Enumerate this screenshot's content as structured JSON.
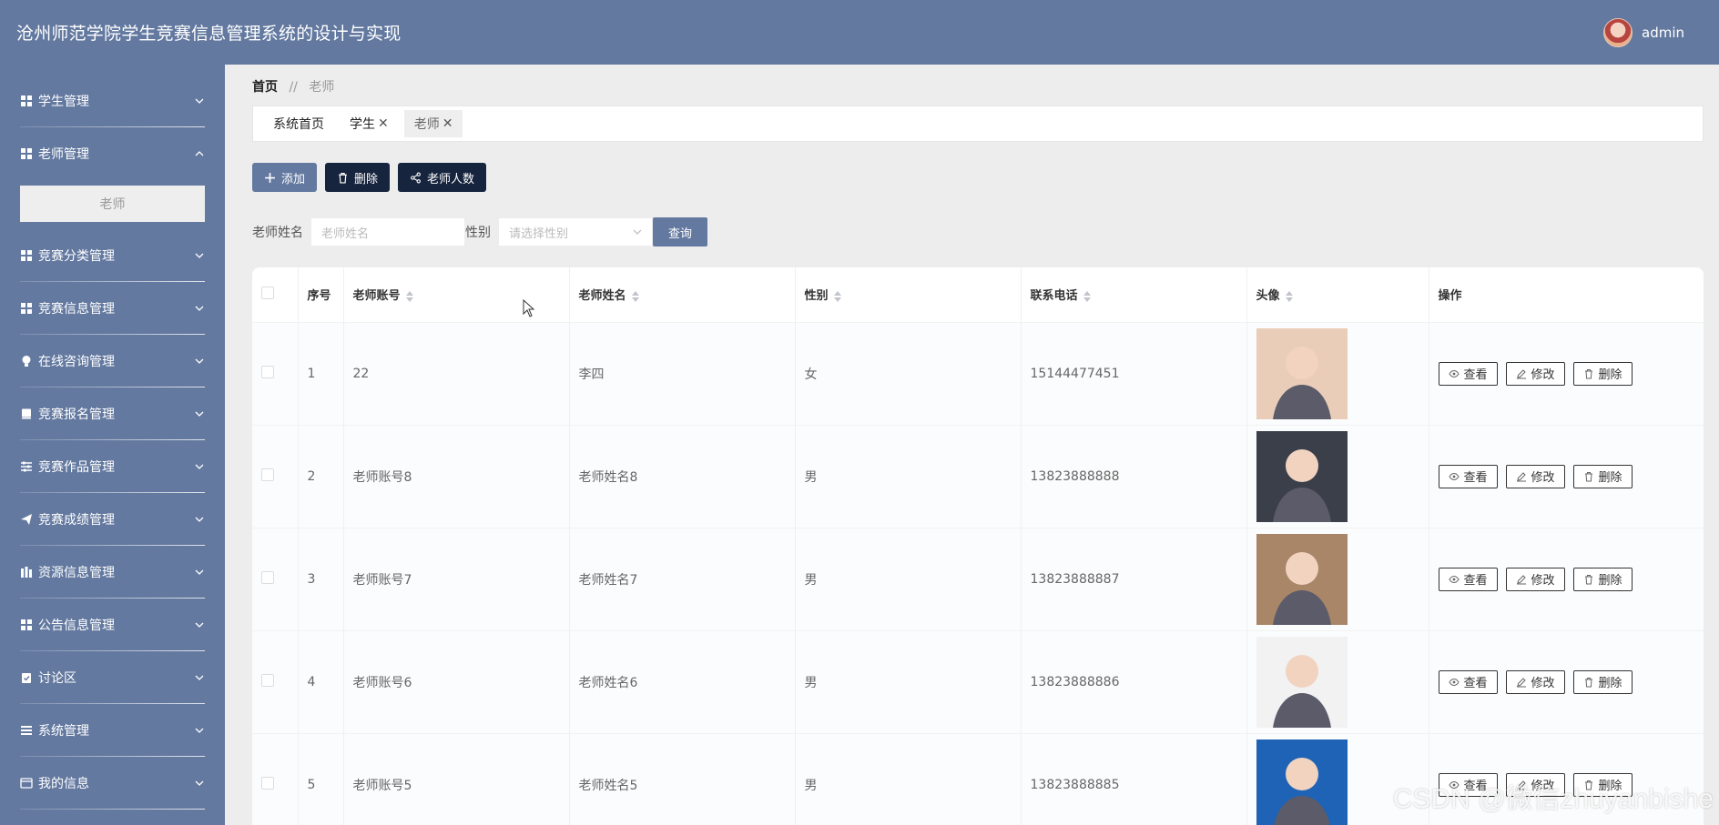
{
  "app": {
    "title": "沧州师范学院学生竞赛信息管理系统的设计与实现",
    "user": "admin"
  },
  "sidebar": {
    "items": [
      {
        "label": "学生管理",
        "icon": "grid-icon",
        "open": false
      },
      {
        "label": "老师管理",
        "icon": "grid-icon",
        "open": true,
        "children": [
          "老师"
        ]
      },
      {
        "label": "竞赛分类管理",
        "icon": "grid-icon",
        "open": false
      },
      {
        "label": "竞赛信息管理",
        "icon": "grid-icon",
        "open": false
      },
      {
        "label": "在线咨询管理",
        "icon": "bulb-icon",
        "open": false
      },
      {
        "label": "竞赛报名管理",
        "icon": "book-icon",
        "open": false
      },
      {
        "label": "竞赛作品管理",
        "icon": "sliders-icon",
        "open": false
      },
      {
        "label": "竞赛成绩管理",
        "icon": "plane-icon",
        "open": false
      },
      {
        "label": "资源信息管理",
        "icon": "columns-icon",
        "open": false
      },
      {
        "label": "公告信息管理",
        "icon": "grid-icon",
        "open": false
      },
      {
        "label": "讨论区",
        "icon": "clipboard-icon",
        "open": false
      },
      {
        "label": "系统管理",
        "icon": "list-icon",
        "open": false
      },
      {
        "label": "我的信息",
        "icon": "window-icon",
        "open": false
      }
    ]
  },
  "breadcrumb": {
    "home": "首页",
    "sep": "//",
    "current": "老师"
  },
  "tabs": [
    {
      "label": "系统首页",
      "closable": false,
      "active": false
    },
    {
      "label": "学生",
      "closable": true,
      "active": false
    },
    {
      "label": "老师",
      "closable": true,
      "active": true
    }
  ],
  "toolbar": {
    "add": "添加",
    "delete": "删除",
    "count": "老师人数"
  },
  "search": {
    "name_label": "老师姓名",
    "name_placeholder": "老师姓名",
    "gender_label": "性别",
    "gender_placeholder": "请选择性别",
    "query": "查询"
  },
  "table": {
    "headers": [
      "序号",
      "老师账号",
      "老师姓名",
      "性别",
      "联系电话",
      "头像",
      "操作"
    ],
    "rows": [
      {
        "index": "1",
        "account": "22",
        "name": "李四",
        "gender": "女",
        "phone": "15144477451",
        "photo_color": "#e9cdb8"
      },
      {
        "index": "2",
        "account": "老师账号8",
        "name": "老师姓名8",
        "gender": "男",
        "phone": "13823888888",
        "photo_color": "#3a3f49"
      },
      {
        "index": "3",
        "account": "老师账号7",
        "name": "老师姓名7",
        "gender": "男",
        "phone": "13823888887",
        "photo_color": "#a98667"
      },
      {
        "index": "4",
        "account": "老师账号6",
        "name": "老师姓名6",
        "gender": "男",
        "phone": "13823888886",
        "photo_color": "#f2f2f2"
      },
      {
        "index": "5",
        "account": "老师账号5",
        "name": "老师姓名5",
        "gender": "男",
        "phone": "13823888885",
        "photo_color": "#1e63b5"
      }
    ],
    "actions": {
      "view": "查看",
      "edit": "修改",
      "delete": "删除"
    }
  },
  "watermark": "CSDN @微信zhuyanbishe",
  "colors": {
    "primary": "#6379a0",
    "dark": "#17243d",
    "background": "#ededed"
  }
}
